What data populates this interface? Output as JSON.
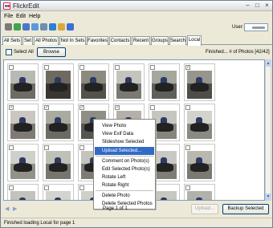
{
  "window": {
    "title": "FlickrEdit"
  },
  "menu": {
    "items": [
      "File",
      "Edit",
      "Help"
    ]
  },
  "toolbar": {
    "icons": [
      {
        "name": "connect-icon",
        "color": "#7a7a7a"
      },
      {
        "name": "refresh-icon",
        "color": "#3fa34d"
      },
      {
        "name": "search-icon",
        "color": "#4a78c8"
      },
      {
        "name": "upload-icon",
        "color": "#5a9ad9"
      },
      {
        "name": "image-icon",
        "color": "#6b8fb5"
      },
      {
        "name": "download-icon",
        "color": "#2e7fd1"
      },
      {
        "name": "folder-icon",
        "color": "#d9a93c"
      },
      {
        "name": "help-icon",
        "color": "#3a6fd8"
      }
    ],
    "user_label": "User:"
  },
  "tabs": [
    {
      "label": "All Sets",
      "active": false
    },
    {
      "label": "Set",
      "active": false
    },
    {
      "label": "All Photos",
      "active": false
    },
    {
      "label": "Not In Sets",
      "active": false
    },
    {
      "label": "Favorites",
      "active": false
    },
    {
      "label": "Contacts",
      "active": false
    },
    {
      "label": "Recent",
      "active": false
    },
    {
      "label": "Groups",
      "active": false
    },
    {
      "label": "Search",
      "active": false
    },
    {
      "label": "Local",
      "active": true
    }
  ],
  "controls": {
    "select_all_label": "Select All",
    "browse_label": "Browse",
    "status": "Finished... # of Photos [42/42]"
  },
  "photos": [
    {
      "checked": false,
      "sky": "#b9b9b4",
      "ground": "#6d6d66"
    },
    {
      "checked": false,
      "sky": "#6f6a5f",
      "ground": "#3a3630"
    },
    {
      "checked": false,
      "sky": "#8c8a80",
      "ground": "#55524b"
    },
    {
      "checked": false,
      "sky": "#c4c4bd",
      "ground": "#7b7a72"
    },
    {
      "checked": false,
      "sky": "#a5a79c",
      "ground": "#5f6059"
    },
    {
      "checked": true,
      "sky": "#96968e",
      "ground": "#4f4d47"
    },
    {
      "checked": true,
      "sky": "#c9c7c0",
      "ground": "#7d7b73"
    },
    {
      "checked": true,
      "sky": "#a9aba1",
      "ground": "#6a6b63"
    },
    {
      "checked": true,
      "sky": "#8e8e86",
      "ground": "#56554f"
    },
    {
      "checked": true,
      "sky": "#b2b0a8",
      "ground": "#6f6d66"
    },
    {
      "checked": false,
      "sky": "#c6c6c0",
      "ground": "#86857d"
    },
    {
      "checked": false,
      "sky": "#d2d3cc",
      "ground": "#8a8a82"
    },
    {
      "checked": false,
      "sky": "#cfd0c9",
      "ground": "#93928a"
    },
    {
      "checked": false,
      "sky": "#bfc0b8",
      "ground": "#76756e"
    },
    {
      "checked": false,
      "sky": "#c4c3bc",
      "ground": "#7d7c75"
    },
    {
      "checked": false,
      "sky": "#9fa196",
      "ground": "#5d5c55"
    },
    {
      "checked": false,
      "sky": "#c8c9c2",
      "ground": "#7e7d76"
    },
    {
      "checked": false,
      "sky": "#b8b8b1",
      "ground": "#7a7972"
    },
    {
      "checked": false,
      "sky": "#c3c2bb",
      "ground": "#7f7e77"
    },
    {
      "checked": false,
      "sky": "#d4d4ce",
      "ground": "#8d8c85"
    },
    {
      "checked": false,
      "sky": "#cfcfc9",
      "ground": "#8e8d86"
    },
    {
      "checked": false,
      "sky": "#bdbdb6",
      "ground": "#787771"
    },
    {
      "checked": false,
      "sky": "#c7c6bf",
      "ground": "#8b8a83"
    },
    {
      "checked": false,
      "sky": "#b1b2aa",
      "ground": "#6c6c65"
    }
  ],
  "context_menu": {
    "items": [
      "View Photo",
      "View Exif Data",
      "Slideshow Selected",
      "Upload Selected...",
      "Comment on Photo(s)",
      "Edit Selected Photo(s)",
      "Rotate Left",
      "Rotate Right",
      "Delete Photo",
      "Delete Selected Photos"
    ],
    "highlighted": "Upload Selected..."
  },
  "bottom": {
    "prev_icon": "arrow-left-icon",
    "next_icon": "arrow-right-icon",
    "page_info": "Page 1 of 1",
    "upload_label": "Upload...",
    "backup_label": "Backup Selected"
  },
  "statusbar": {
    "text": "Finished loading Local for page 1"
  }
}
